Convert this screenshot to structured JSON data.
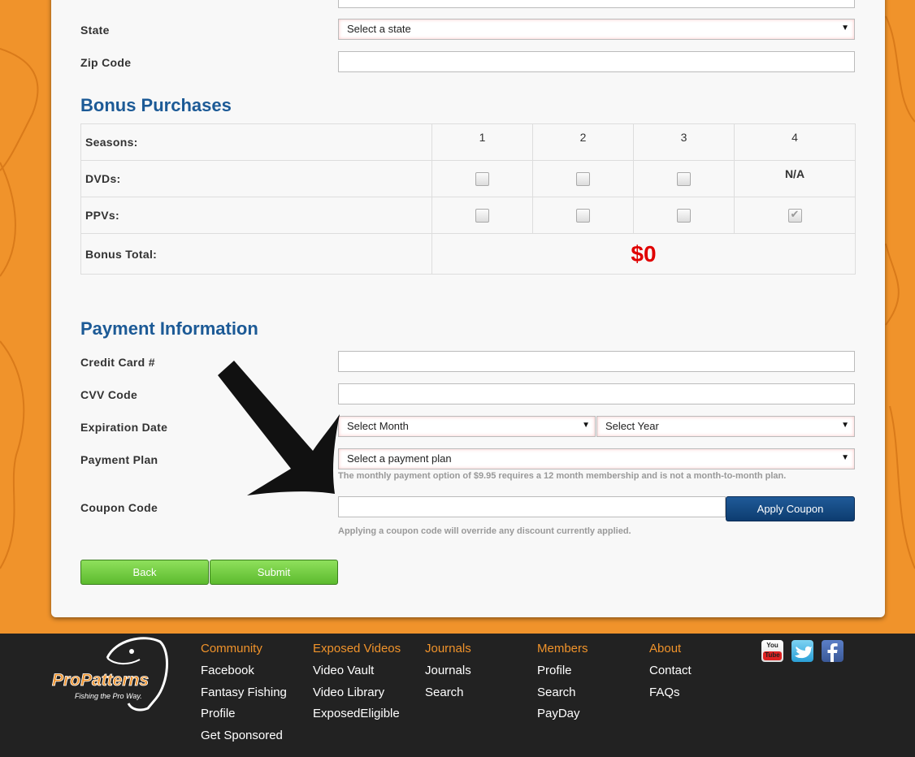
{
  "address": {
    "state_label": "State",
    "state_value": "Select a state",
    "zip_label": "Zip Code"
  },
  "bonus": {
    "heading": "Bonus Purchases",
    "seasons_label": "Seasons:",
    "seasons": [
      "1",
      "2",
      "3",
      "4"
    ],
    "dvds_label": "DVDs:",
    "dvd_na": "N/A",
    "ppvs_label": "PPVs:",
    "total_label": "Bonus Total:",
    "total_value": "$0",
    "total_color": "#e00000"
  },
  "payment": {
    "heading": "Payment Information",
    "cc_label": "Credit Card #",
    "cvv_label": "CVV Code",
    "exp_label": "Expiration Date",
    "month_value": "Select Month",
    "year_value": "Select Year",
    "plan_label": "Payment Plan",
    "plan_value": "Select a payment plan",
    "plan_note": "The monthly payment option of $9.95 requires a 12 month membership and is not a month-to-month plan.",
    "coupon_label": "Coupon Code",
    "apply_button": "Apply Coupon",
    "coupon_note": "Applying a coupon code will override any discount currently applied."
  },
  "actions": {
    "back": "Back",
    "submit": "Submit"
  },
  "footer": {
    "logo_text": "ProPatterns",
    "logo_tagline": "Fishing the Pro Way.",
    "columns": [
      {
        "heading": "Community",
        "links": [
          "Facebook",
          "Fantasy Fishing",
          "Profile",
          "Get Sponsored"
        ]
      },
      {
        "heading": "Exposed Videos",
        "links": [
          "Video Vault",
          "Video Library",
          "ExposedEligible"
        ]
      },
      {
        "heading": "Journals",
        "links": [
          "Journals",
          "Search"
        ]
      },
      {
        "heading": "Members",
        "links": [
          "Profile",
          "Search",
          "PayDay"
        ]
      },
      {
        "heading": "About",
        "links": [
          "Contact",
          "FAQs"
        ]
      }
    ],
    "social": {
      "youtube_text": "You Tube",
      "youtube_icon": "youtube-icon",
      "twitter_icon": "twitter-icon",
      "facebook_icon": "facebook-icon"
    }
  },
  "colors": {
    "background": "#f0932b",
    "heading_blue": "#1c5a96",
    "footer_heading": "#f0932b"
  }
}
